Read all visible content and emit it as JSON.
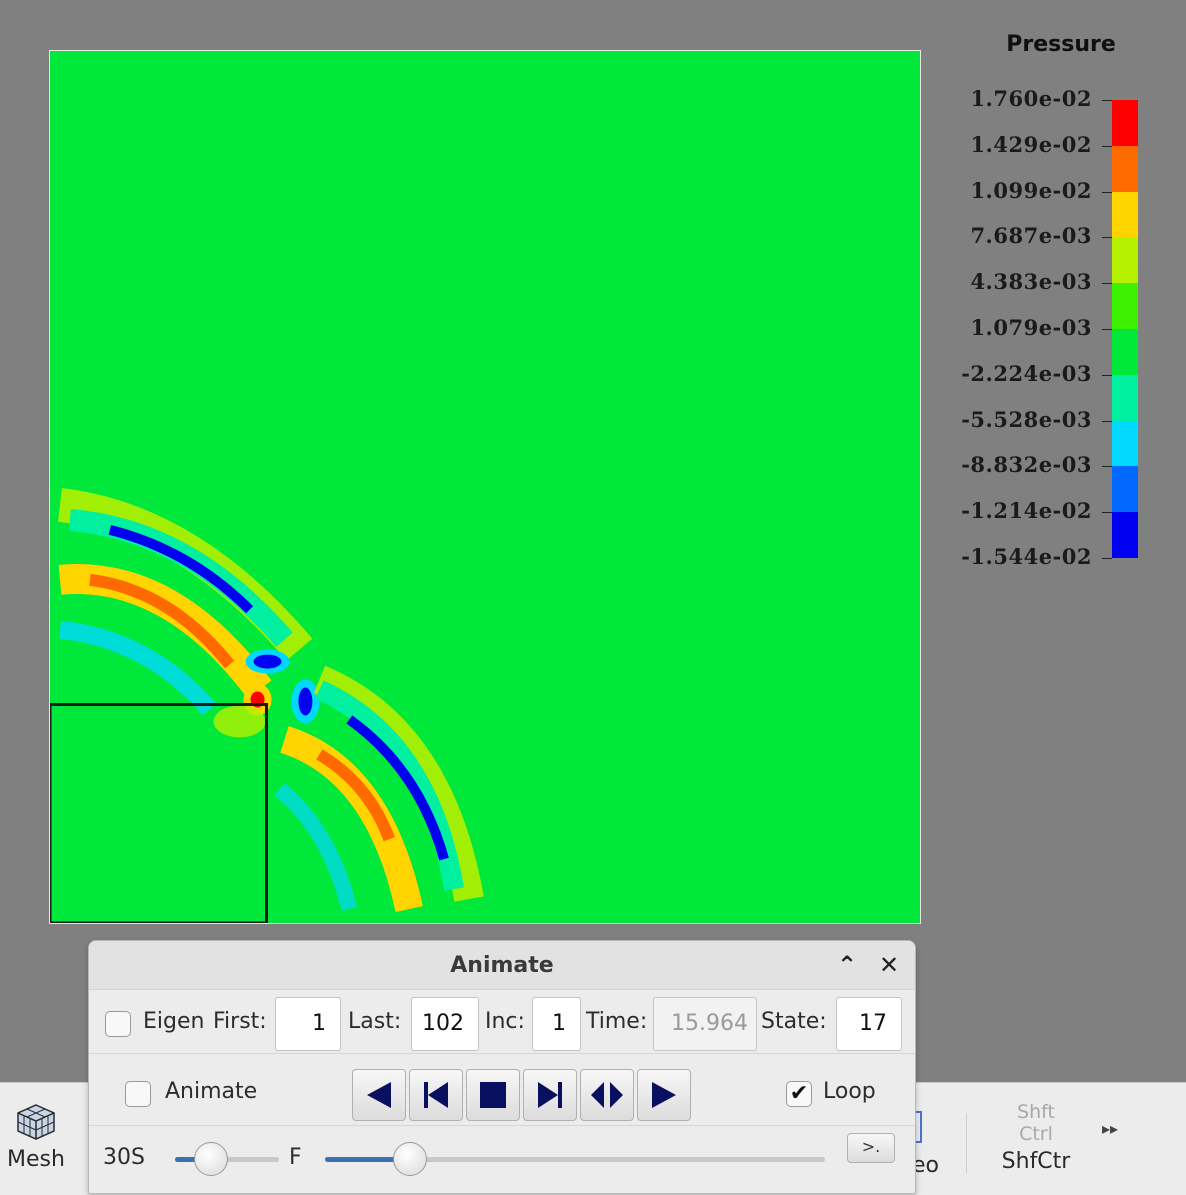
{
  "legend": {
    "title": "Pressure",
    "labels": [
      "1.760e-02",
      "1.429e-02",
      "1.099e-02",
      "7.687e-03",
      "4.383e-03",
      "1.079e-03",
      "-2.224e-03",
      "-5.528e-03",
      "-8.832e-03",
      "-1.214e-02",
      "-1.544e-02"
    ],
    "colors": [
      "#ff0000",
      "#ff6a00",
      "#ffd400",
      "#b4f000",
      "#3cf000",
      "#00e83a",
      "#00f0a0",
      "#00d8ff",
      "#0068ff",
      "#0000f0"
    ]
  },
  "plot": {
    "background_color": "#00e83a"
  },
  "dialog": {
    "title": "Animate",
    "eigen_label": "Eigen",
    "eigen_checked": false,
    "first_label": "First:",
    "first_value": "1",
    "last_label": "Last:",
    "last_value": "102",
    "inc_label": "Inc:",
    "inc_value": "1",
    "time_label": "Time:",
    "time_value": "15.964",
    "state_label": "State:",
    "state_value": "17",
    "animate_label": "Animate",
    "animate_checked": false,
    "loop_label": "Loop",
    "loop_checked": true,
    "speed_slow_label": "30S",
    "speed_fast_label": "F",
    "speed_level": 0.35,
    "state_level": 0.17,
    "command_button_label": ">."
  },
  "toolbar": {
    "mesh_label": "Mesh",
    "video_label_partial": "eo",
    "shf_small_1": "Shft",
    "shf_small_2": "Ctrl",
    "shf_label": "ShfCtr",
    "more_icon": "double-chevron-right-icon"
  }
}
